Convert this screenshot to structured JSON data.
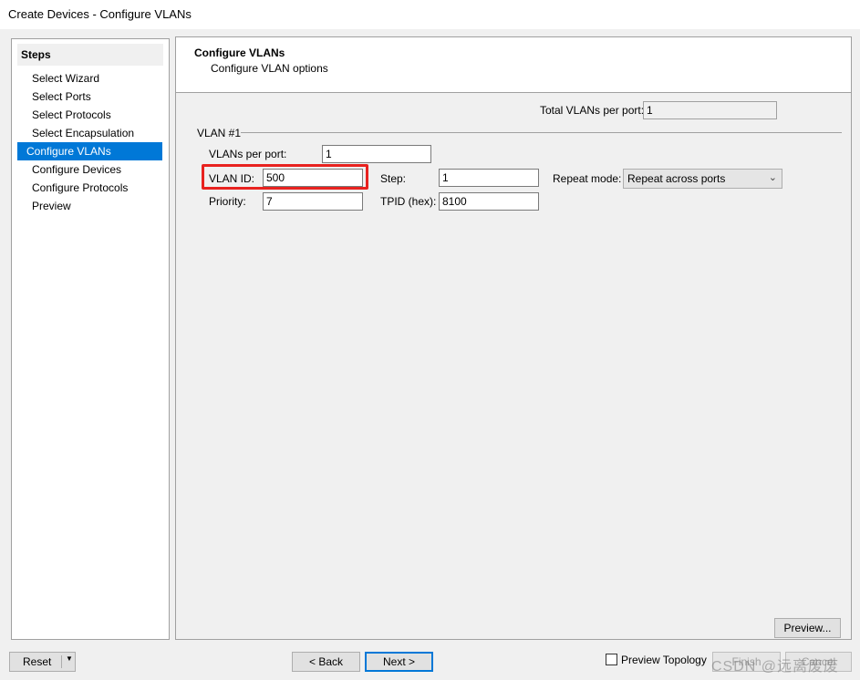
{
  "window": {
    "title": "Create Devices - Configure VLANs"
  },
  "steps": {
    "header": "Steps",
    "items": [
      {
        "label": "Select Wizard"
      },
      {
        "label": "Select Ports"
      },
      {
        "label": "Select Protocols"
      },
      {
        "label": "Select Encapsulation"
      },
      {
        "label": "Configure VLANs",
        "selected": true
      },
      {
        "label": "Configure Devices"
      },
      {
        "label": "Configure Protocols"
      },
      {
        "label": "Preview"
      }
    ]
  },
  "main": {
    "title": "Configure VLANs",
    "subtitle": "Configure VLAN options",
    "total_label": "Total VLANs per port:",
    "total_value": "1",
    "group_label": "VLAN #1",
    "vlans_per_port_label": "VLANs per port:",
    "vlans_per_port": "1",
    "vlan_id_label": "VLAN ID:",
    "vlan_id": "500",
    "step_label": "Step:",
    "step": "1",
    "repeat_label": "Repeat mode:",
    "repeat_mode": "Repeat across ports",
    "priority_label": "Priority:",
    "priority": "7",
    "tpid_label": "TPID (hex):",
    "tpid": "8100",
    "preview_button": "Preview..."
  },
  "footer": {
    "reset": "Reset",
    "back": "< Back",
    "next": "Next >",
    "preview_topology": "Preview Topology",
    "preview_topology_checked": false,
    "finish": "Finish",
    "cancel": "Cancel"
  },
  "watermark": "CSDN @远离废废",
  "colors": {
    "selection": "#0078d7",
    "highlight": "#e8221f"
  }
}
